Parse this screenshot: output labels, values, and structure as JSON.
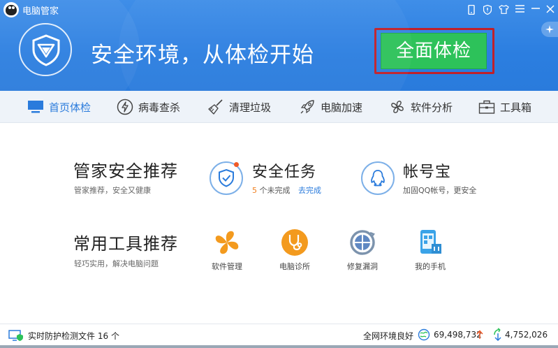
{
  "app": {
    "title": "电脑管家"
  },
  "window_controls": [
    {
      "name": "phone-icon"
    },
    {
      "name": "shield-small-icon"
    },
    {
      "name": "tshirt-skin-icon"
    },
    {
      "name": "menu-icon"
    },
    {
      "name": "minimize-icon"
    },
    {
      "name": "close-icon"
    }
  ],
  "hero": {
    "slogan": "安全环境，从体检开始",
    "scan_button_label": "全面体检",
    "sparkle_icon": "sparkle-icon"
  },
  "nav": {
    "tabs": [
      {
        "label": "首页体检",
        "icon": "monitor-icon",
        "active": true
      },
      {
        "label": "病毒查杀",
        "icon": "lightning-icon",
        "active": false
      },
      {
        "label": "清理垃圾",
        "icon": "broom-icon",
        "active": false
      },
      {
        "label": "电脑加速",
        "icon": "rocket-icon",
        "active": false
      },
      {
        "label": "软件分析",
        "icon": "clover-icon",
        "active": false
      },
      {
        "label": "工具箱",
        "icon": "toolbox-icon",
        "active": false
      }
    ]
  },
  "recommend": {
    "title": "管家安全推荐",
    "subtitle": "管家推荐，安全又健康",
    "tasks": {
      "title": "安全任务",
      "count": "5",
      "pending_text": "个未完成",
      "link": "去完成"
    },
    "account": {
      "title": "帐号宝",
      "subtitle": "加固QQ帐号，更安全"
    }
  },
  "tools": {
    "title": "常用工具推荐",
    "subtitle": "轻巧实用，解决电脑问题",
    "items": [
      {
        "label": "软件管理",
        "icon": "software-manager-icon"
      },
      {
        "label": "电脑诊所",
        "icon": "stethoscope-icon"
      },
      {
        "label": "修复漏洞",
        "icon": "patch-repair-icon"
      },
      {
        "label": "我的手机",
        "icon": "my-phone-icon"
      }
    ]
  },
  "status": {
    "realtime_text": "实时防护检测文件",
    "realtime_count": "16",
    "realtime_unit": "个",
    "network_text": "全网环境良好",
    "stat1": "69,498,732",
    "stat2": "4,752,026"
  },
  "colors": {
    "header_blue": "#2b7ee0",
    "scan_green": "#2dc25a",
    "highlight_red": "#c0202a",
    "accent_orange": "#f08020",
    "link_blue": "#2a7bdc"
  }
}
